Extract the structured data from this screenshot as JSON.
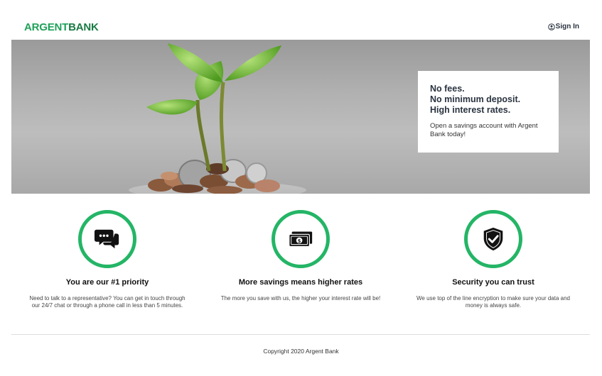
{
  "header": {
    "logo_part1": "ARGENT",
    "logo_part2": "BANK",
    "sign_in": "Sign In",
    "sign_in_icon": "user-circle-icon"
  },
  "hero": {
    "image": "plant-growing-from-coins",
    "headline_line1": "No fees.",
    "headline_line2": "No minimum deposit.",
    "headline_line3": "High interest rates.",
    "body": "Open a savings account with Argent Bank today!"
  },
  "features": [
    {
      "icon": "chat-icon",
      "title": "You are our #1 priority",
      "text": "Need to talk to a representative? You can get in touch through our 24/7 chat or through a phone call in less than 5 minutes."
    },
    {
      "icon": "money-icon",
      "title": "More savings means higher rates",
      "text": "The more you save with us, the higher your interest rate will be!"
    },
    {
      "icon": "security-shield-icon",
      "title": "Security you can trust",
      "text": "We use top of the line encryption to make sure your data and money is always safe."
    }
  ],
  "footer": {
    "copyright": "Copyright 2020 Argent Bank"
  },
  "colors": {
    "accent": "#24b566",
    "logo": "#1fa15a",
    "heading": "#2a3340"
  }
}
